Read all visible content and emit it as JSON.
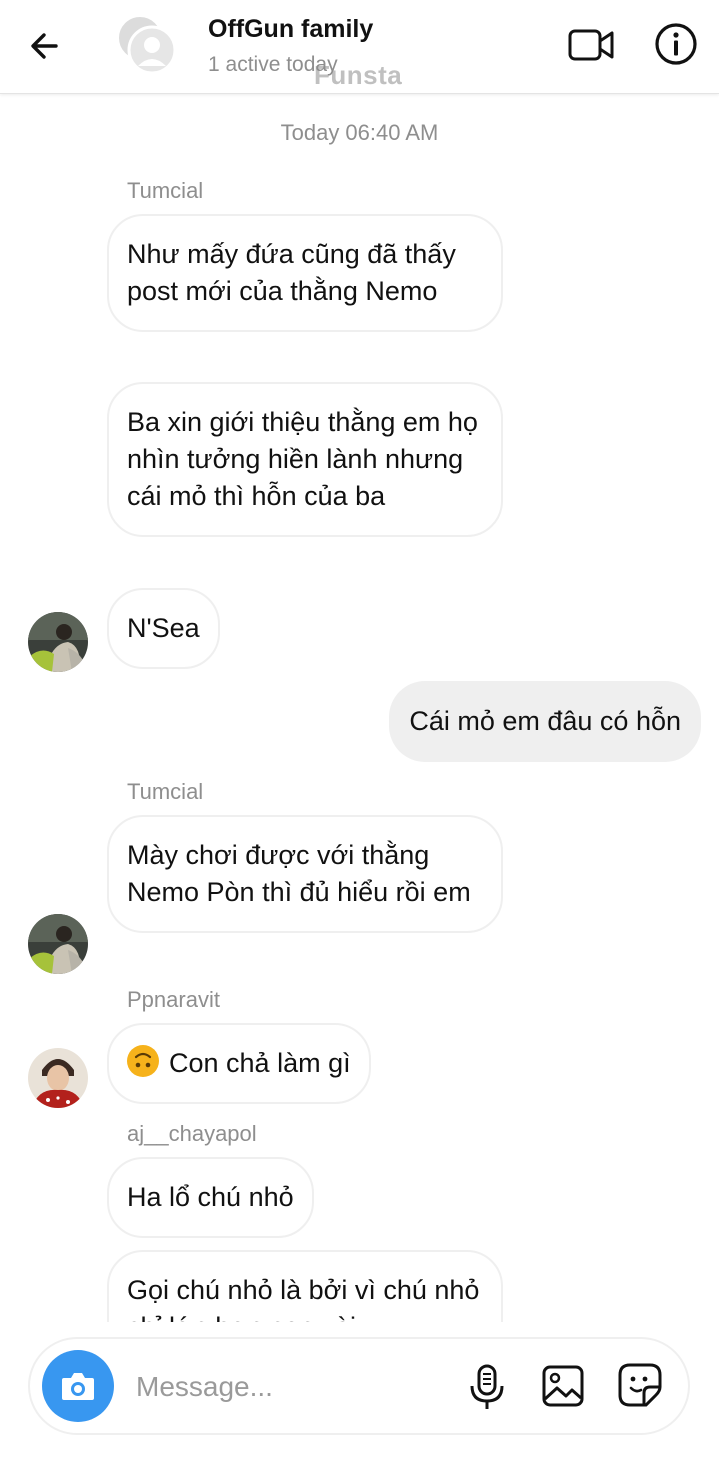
{
  "header": {
    "title": "OffGun family",
    "subtitle": "1 active today",
    "watermark": "Funsta",
    "icons": {
      "back": "arrow-left-icon",
      "video": "video-call-icon",
      "info": "info-icon"
    }
  },
  "chat": {
    "timestamp": "Today 06:40 AM",
    "messages": [
      {
        "sender": "Tumcial",
        "text": "Như mấy đứa cũng đã thấy post mới của thằng Nemo"
      },
      {
        "text": "Ba xin giới thiệu thằng em họ nhìn tưởng hiền lành nhưng cái mỏ thì hỗn của ba"
      },
      {
        "text": "N'Sea"
      },
      {
        "text": "Cái mỏ em đâu có hỗn"
      },
      {
        "sender": "Tumcial",
        "text": "Mày chơi được với thằng Nemo Pòn thì đủ hiểu rồi em"
      },
      {
        "sender": "Ppnaravit",
        "text": "Con chả làm gì",
        "emoji": "upside-down-face"
      },
      {
        "sender": "aj__chayapol",
        "text": "Ha lổ chú nhỏ"
      },
      {
        "text": "Gọi chú nhỏ là bởi vì chú nhỏ chỉ lớn hơn con vài"
      }
    ]
  },
  "composer": {
    "placeholder": "Message...",
    "icons": {
      "camera": "camera-icon",
      "mic": "microphone-icon",
      "gallery": "image-icon",
      "sticker": "sticker-icon"
    }
  },
  "colors": {
    "accent": "#3897f0",
    "bubble_out": "#efefef",
    "muted_text": "#8e8e8e"
  }
}
